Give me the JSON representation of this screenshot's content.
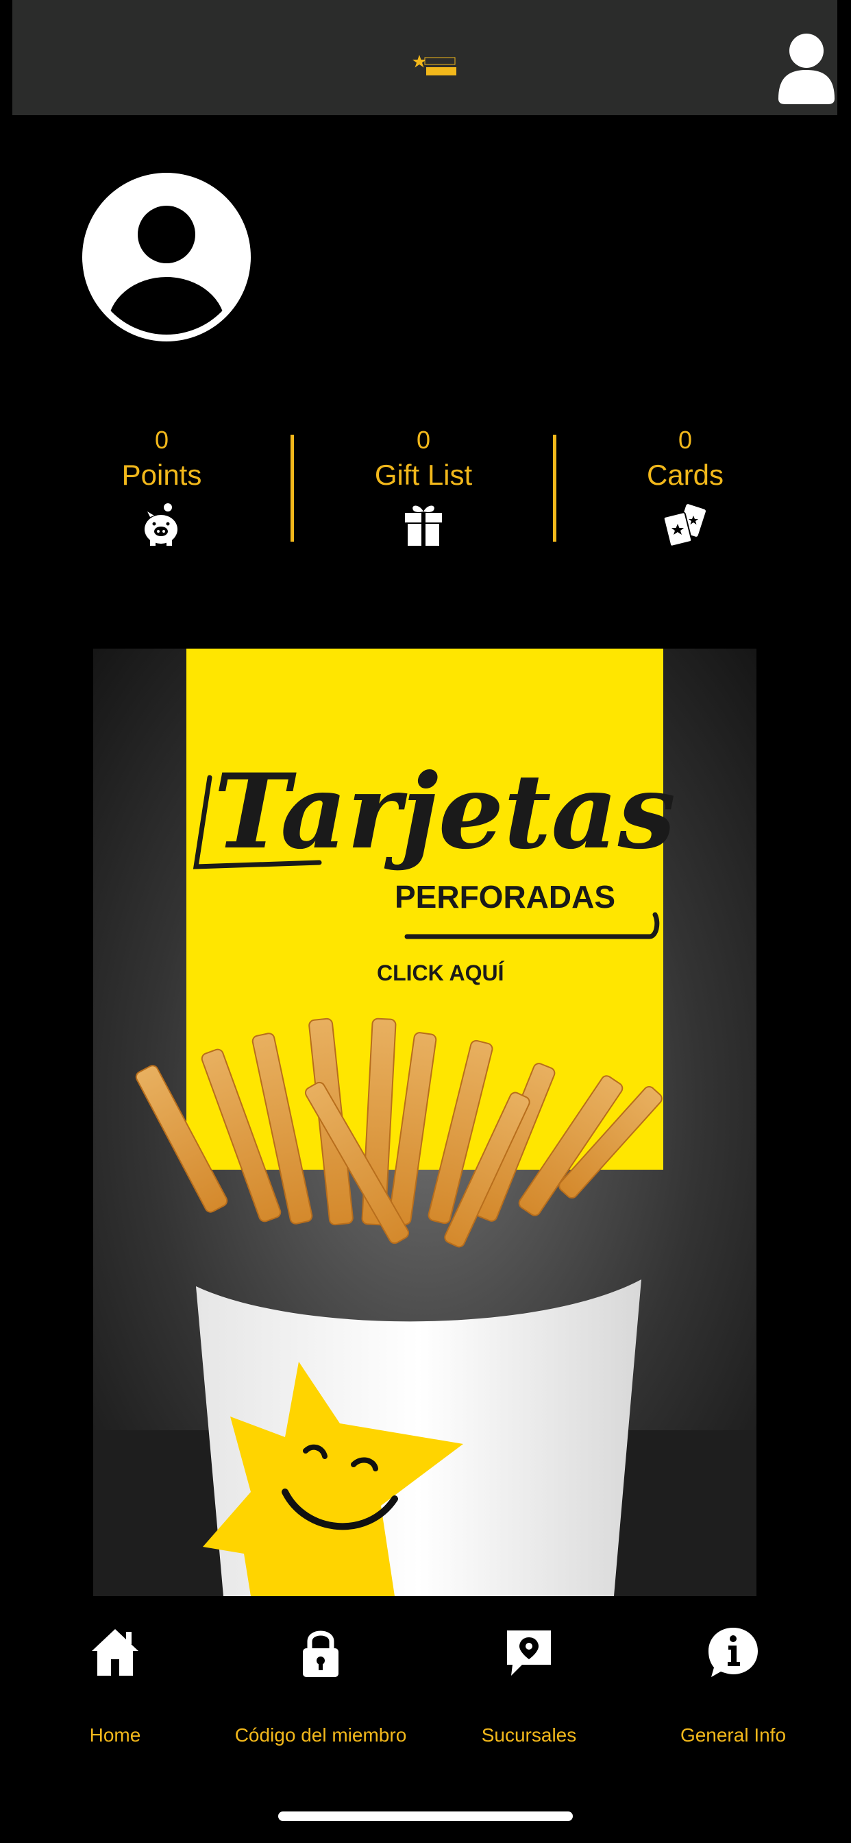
{
  "header": {
    "logo_icon": "brand-star-logo-icon",
    "profile_icon": "user-profile-icon"
  },
  "profile": {
    "avatar_icon": "user-avatar-icon"
  },
  "stats": [
    {
      "count": "0",
      "label": "Points",
      "icon": "piggy-bank-icon"
    },
    {
      "count": "0",
      "label": "Gift List",
      "icon": "gift-icon"
    },
    {
      "count": "0",
      "label": "Cards",
      "icon": "cards-icon"
    }
  ],
  "banner": {
    "title": "Tarjetas",
    "subtitle": "PERFORADAS",
    "cta": "CLICK AQUÍ"
  },
  "nav": [
    {
      "label": "Home",
      "icon": "home-icon"
    },
    {
      "label": "Código del miembro",
      "icon": "lock-icon"
    },
    {
      "label": "Sucursales",
      "icon": "location-pin-icon"
    },
    {
      "label": "General Info",
      "icon": "info-icon"
    }
  ],
  "colors": {
    "accent": "#f2b81b",
    "banner_yellow": "#ffe600",
    "background": "#000000",
    "header": "#2b2c2b"
  }
}
